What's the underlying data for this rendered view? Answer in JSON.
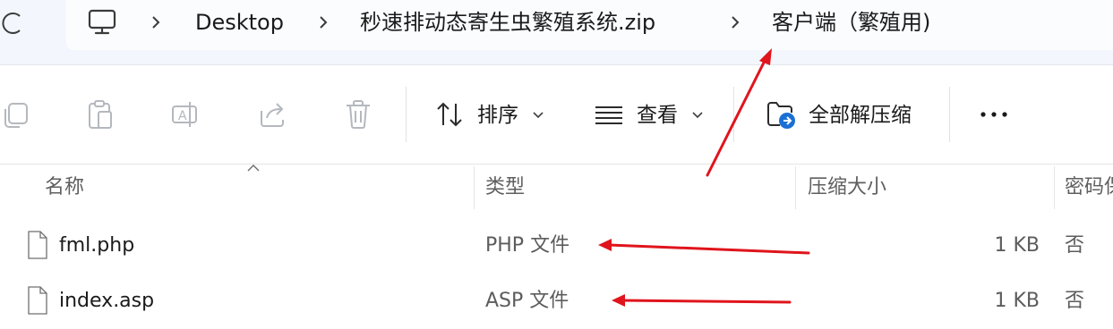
{
  "breadcrumb": {
    "items": [
      "Desktop",
      "秒速排动态寄生虫繁殖系统.zip",
      "客户端（繁殖用)"
    ]
  },
  "toolbar": {
    "sort_label": "排序",
    "view_label": "查看",
    "extract_all_label": "全部解压缩"
  },
  "columns": {
    "name": "名称",
    "type": "类型",
    "compressed_size": "压缩大小",
    "password": "密码保"
  },
  "files": [
    {
      "name": "fml.php",
      "type": "PHP 文件",
      "size": "1 KB",
      "password": "否"
    },
    {
      "name": "index.asp",
      "type": "ASP 文件",
      "size": "1 KB",
      "password": "否"
    }
  ],
  "colors": {
    "annotation_arrow": "#e0141c",
    "address_bar_bg": "#f3f6fc",
    "extract_badge": "#1a6fd4"
  },
  "icons": [
    "refresh-icon",
    "computer-icon",
    "copy-icon",
    "paste-icon",
    "rename-icon",
    "share-icon",
    "delete-icon",
    "sort-icon",
    "view-icon",
    "extract-all-icon",
    "more-icon",
    "file-icon"
  ]
}
